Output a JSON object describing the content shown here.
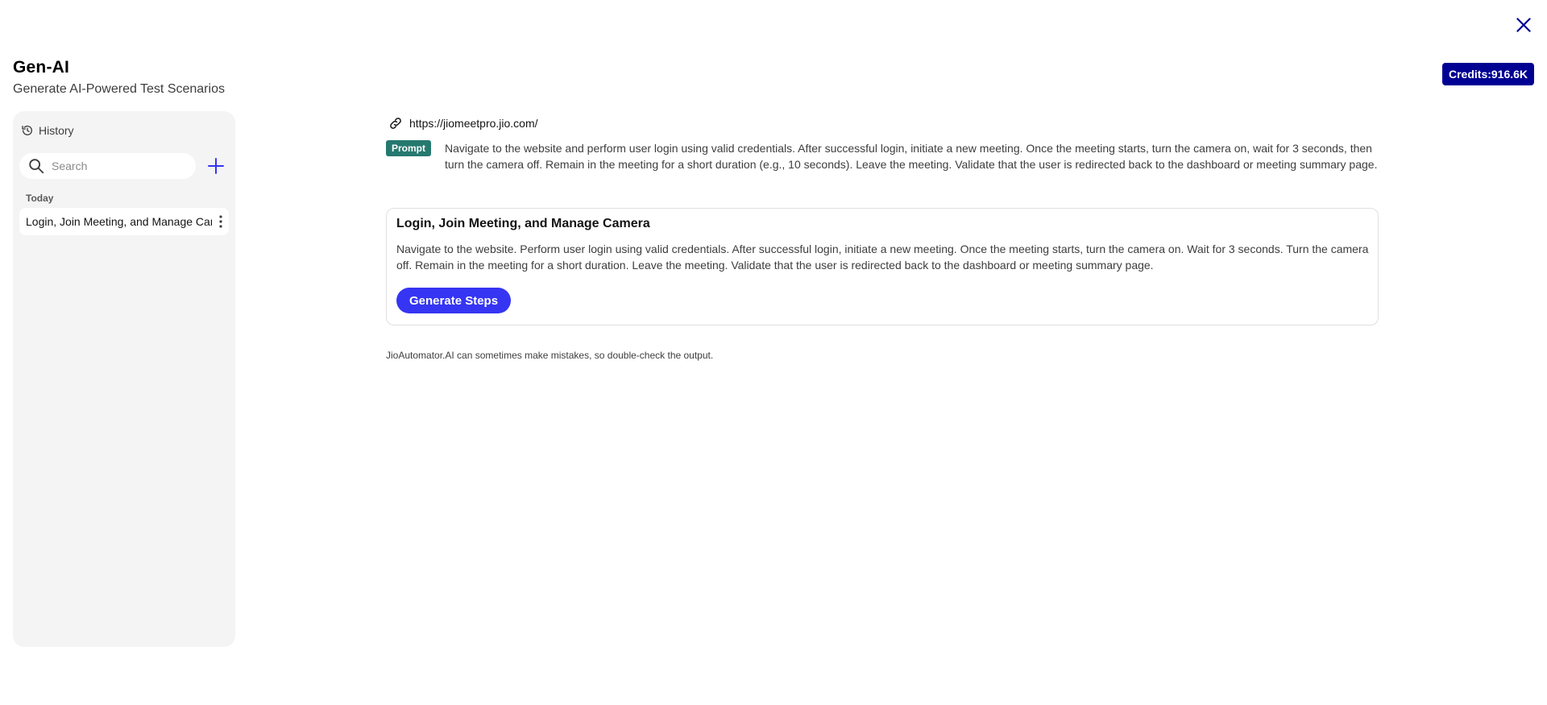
{
  "header": {
    "title": "Gen-AI",
    "subtitle": "Generate AI-Powered Test Scenarios"
  },
  "credits": {
    "label": "Credits:916.6K",
    "color": "#000093"
  },
  "sidebar": {
    "history_label": "History",
    "search": {
      "placeholder": "Search",
      "value": ""
    },
    "sections": [
      {
        "label": "Today",
        "items": [
          {
            "label": "Login, Join Meeting, and Manage Camera"
          }
        ]
      }
    ]
  },
  "main": {
    "url": "https://jiomeetpro.jio.com/",
    "prompt_badge": "Prompt",
    "prompt_text": "Navigate to the website and perform user login using valid credentials. After successful login, initiate a new meeting. Once the meeting starts, turn the camera on, wait for 3 seconds, then turn the camera off. Remain in the meeting for a short duration (e.g., 10 seconds). Leave the meeting. Validate that the user is redirected back to the dashboard or meeting summary page.",
    "scenario": {
      "title": "Login, Join Meeting, and Manage Camera",
      "description": "Navigate to the website. Perform user login using valid credentials. After successful login, initiate a new meeting. Once the meeting starts, turn the camera on. Wait for 3 seconds. Turn the camera off. Remain in the meeting for a short duration. Leave the meeting. Validate that the user is redirected back to the dashboard or meeting summary page.",
      "button_label": "Generate Steps"
    },
    "disclaimer": "JioAutomator.AI can sometimes make mistakes, so double-check the output."
  },
  "icons": {
    "close": "close-icon",
    "history": "history-icon",
    "search": "search-icon",
    "add": "plus-icon",
    "more": "more-vertical-icon",
    "link": "link-icon"
  },
  "colors": {
    "accent": "#3535f3",
    "prompt_badge": "#25796f",
    "sidebar_bg": "#f4f4f4"
  }
}
